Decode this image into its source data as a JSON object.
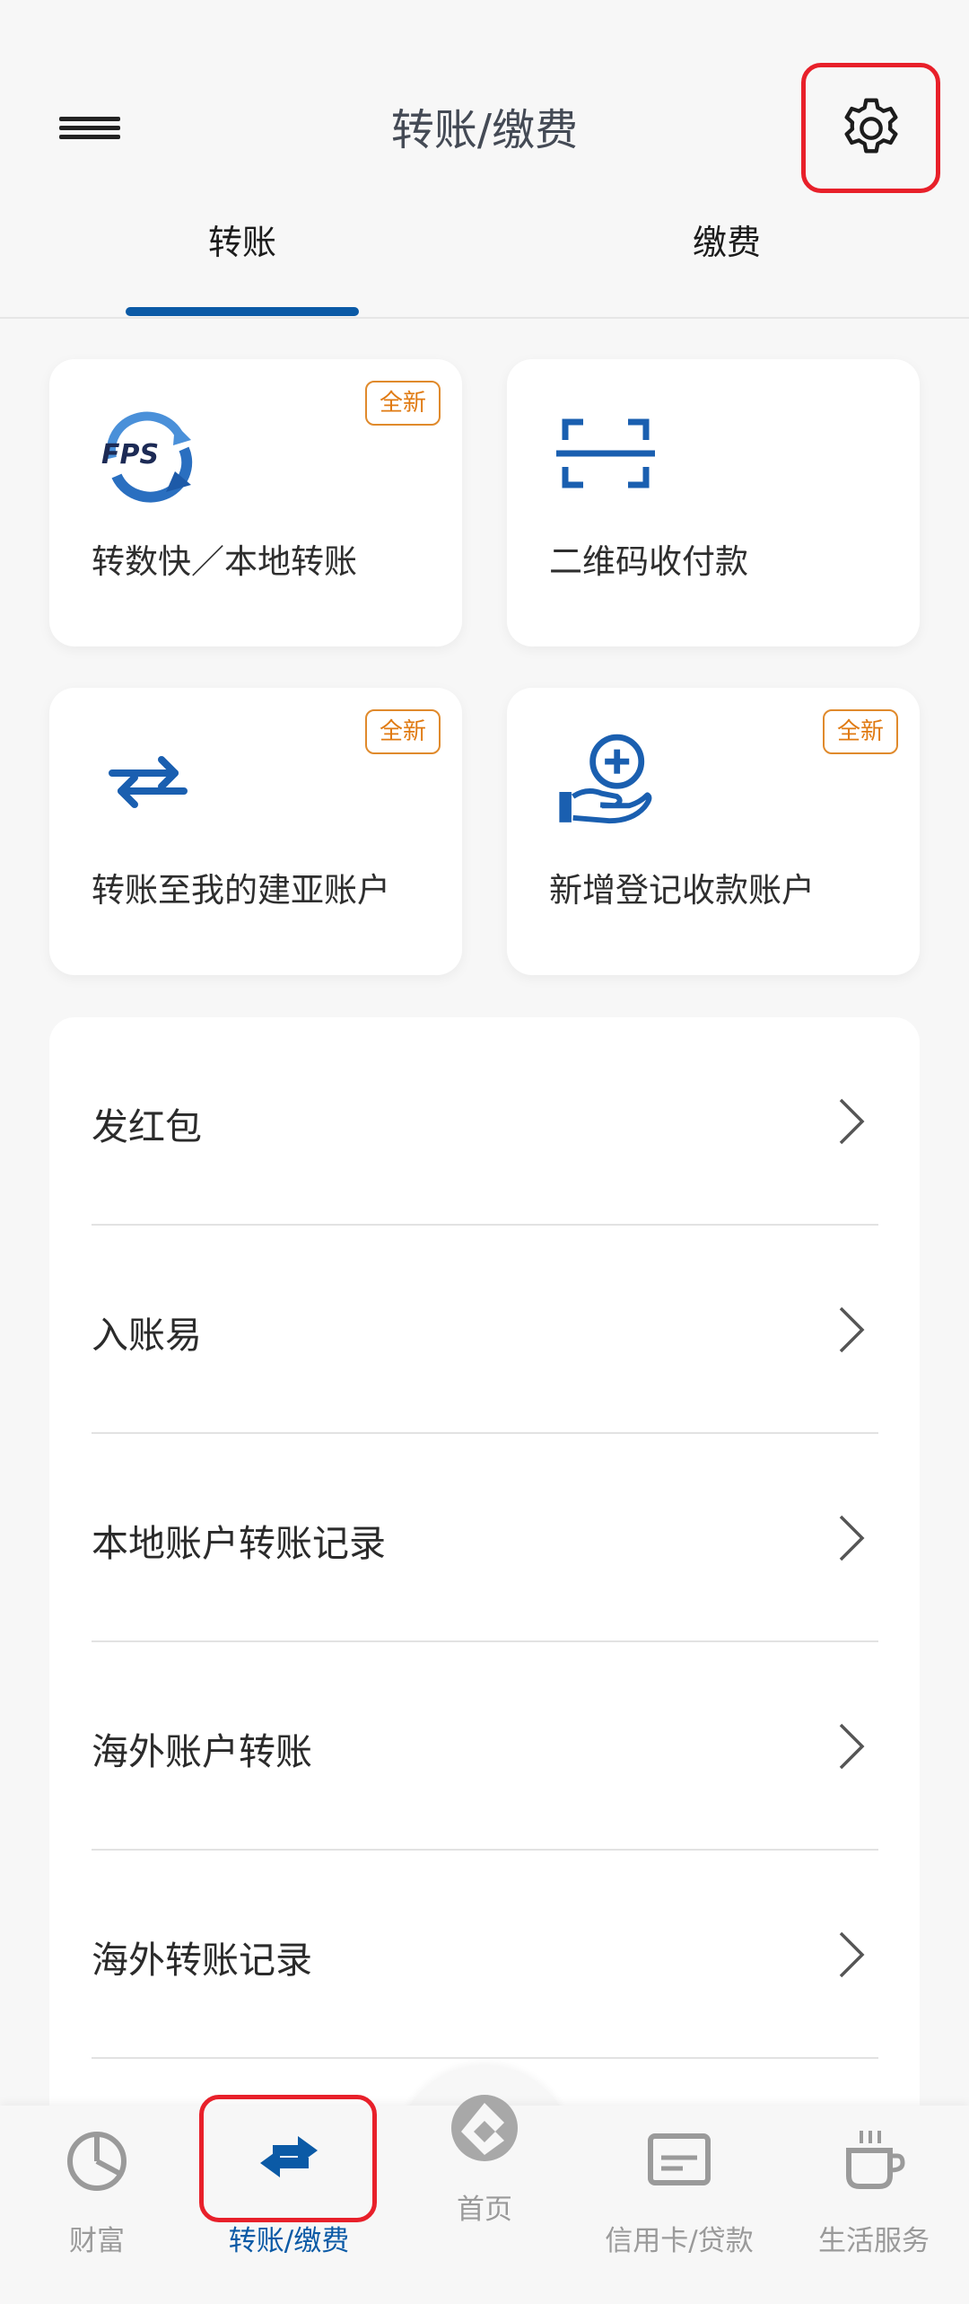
{
  "header": {
    "title": "转账/缴费",
    "menu_icon": "hamburger-icon",
    "settings_icon": "gear-icon"
  },
  "tabs": [
    {
      "label": "转账",
      "active": true
    },
    {
      "label": "缴费",
      "active": false
    }
  ],
  "cards": [
    {
      "label": "转数快／本地转账",
      "badge": "全新",
      "icon": "fps-icon"
    },
    {
      "label": "二维码收付款",
      "badge": "",
      "icon": "qr-scan-icon"
    },
    {
      "label": "转账至我的建亚账户",
      "badge": "全新",
      "icon": "swap-arrows-icon"
    },
    {
      "label": "新增登记收款账户",
      "badge": "全新",
      "icon": "hand-plus-icon"
    }
  ],
  "list": [
    {
      "label": "发红包"
    },
    {
      "label": "入账易"
    },
    {
      "label": "本地账户转账记录"
    },
    {
      "label": "海外账户转账"
    },
    {
      "label": "海外转账记录"
    }
  ],
  "bottom_nav": [
    {
      "label": "财富",
      "icon": "pie-chart-icon"
    },
    {
      "label": "转账/缴费",
      "icon": "transfer-icon",
      "active": true
    },
    {
      "label": "首页",
      "icon": "ccb-logo-icon"
    },
    {
      "label": "信用卡/贷款",
      "icon": "credit-card-icon"
    },
    {
      "label": "生活服务",
      "icon": "coffee-cup-icon"
    }
  ],
  "colors": {
    "accent": "#0b5aa6",
    "badge": "#e07a12",
    "highlight": "#e8202a",
    "background": "#f7f7f7"
  }
}
